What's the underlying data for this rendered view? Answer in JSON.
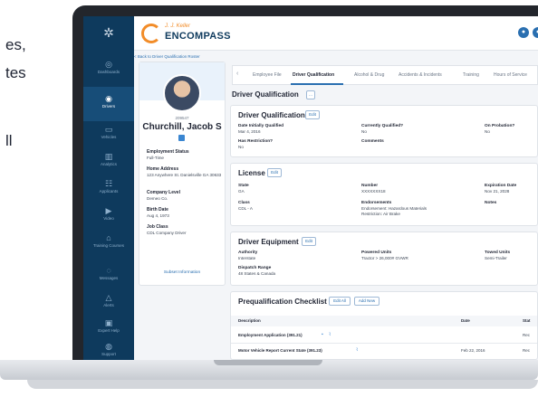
{
  "marketing_fragments": [
    "es,",
    "tes",
    "ll"
  ],
  "sidebar": {
    "logo_icon": "spiral-icon",
    "items": [
      {
        "icon": "dashboard-icon",
        "label": "Dashboards"
      },
      {
        "icon": "driver-icon",
        "label": "Drivers"
      },
      {
        "icon": "truck-icon",
        "label": "Vehicles"
      },
      {
        "icon": "chart-icon",
        "label": "Analytics"
      },
      {
        "icon": "applicants-icon",
        "label": "Applicants"
      },
      {
        "icon": "video-icon",
        "label": "Video"
      },
      {
        "icon": "training-icon",
        "label": "Training Courses"
      },
      {
        "icon": "message-icon",
        "label": "Messages"
      },
      {
        "icon": "alert-icon",
        "label": "Alerts"
      },
      {
        "icon": "help-icon",
        "label": "Expert Help"
      },
      {
        "icon": "support-icon",
        "label": "Support"
      }
    ]
  },
  "brand": {
    "small": "J. J. Keller",
    "big": "ENCOMPASS"
  },
  "back_link": "< Back to Driver Qualification Roster",
  "profile": {
    "id": "209547",
    "name": "Churchill, Jacob S",
    "fields": [
      {
        "label": "Employment Status",
        "value": "Full-Time"
      },
      {
        "label": "Home Address",
        "value": "123 Anywhere St. Danielsville GA 30633"
      },
      {
        "label": "Company Level",
        "value": "Demeo Co."
      },
      {
        "label": "Birth Date",
        "value": "Aug 4, 1973"
      },
      {
        "label": "Job Class",
        "value": "CDL Company Driver"
      }
    ],
    "link": "Subset Information"
  },
  "tabs": [
    "Employee File",
    "Driver Qualification",
    "Alcohol & Drug",
    "Accidents & Incidents",
    "Training",
    "Hours of Service"
  ],
  "active_tab": "Driver Qualification",
  "section_title": "Driver Qualification",
  "dq_card": {
    "title": "Driver Qualification",
    "edit": "Edit",
    "fields": [
      {
        "label": "Date Initially Qualified",
        "value": "Mar 4, 2016"
      },
      {
        "label": "Currently Qualified?",
        "value": "No"
      },
      {
        "label": "On Probation?",
        "value": "No"
      },
      {
        "label": "Has Restriction?",
        "value": "No"
      },
      {
        "label": "Comments",
        "value": ""
      }
    ]
  },
  "license_card": {
    "title": "License",
    "edit": "Edit",
    "fields": [
      {
        "label": "State",
        "value": "GA"
      },
      {
        "label": "Number",
        "value": "XXXXXXX18"
      },
      {
        "label": "Expiration Date",
        "value": "Nov 21, 2028"
      },
      {
        "label": "Class",
        "value": "CDL - A"
      },
      {
        "label": "Endorsements",
        "value": "Endorsement: Hazardous Materials"
      },
      {
        "label": "Restrictions",
        "value": "Restriction: Air Brake"
      },
      {
        "label": "Notes",
        "value": ""
      }
    ]
  },
  "equipment_card": {
    "title": "Driver Equipment",
    "edit": "Edit",
    "fields": [
      {
        "label": "Authority",
        "value": "Interstate"
      },
      {
        "label": "Powered Units",
        "value": "Tractor > 26,000# GVWR"
      },
      {
        "label": "Towed Units",
        "value": "Semi-Trailer"
      },
      {
        "label": "Dispatch Range",
        "value": "48 States & Canada"
      }
    ]
  },
  "checklist": {
    "title": "Prequalification Checklist",
    "edit_all": "Edit All",
    "add_new": "Add New",
    "columns": [
      "Description",
      "Date",
      "Stat"
    ],
    "rows": [
      {
        "description": "Employment Application (391.21)",
        "date": "",
        "status": "Rec"
      },
      {
        "description": "Motor Vehicle Report Current State (391.23)",
        "date": "Feb 22, 2016",
        "status": "Rec"
      }
    ]
  }
}
